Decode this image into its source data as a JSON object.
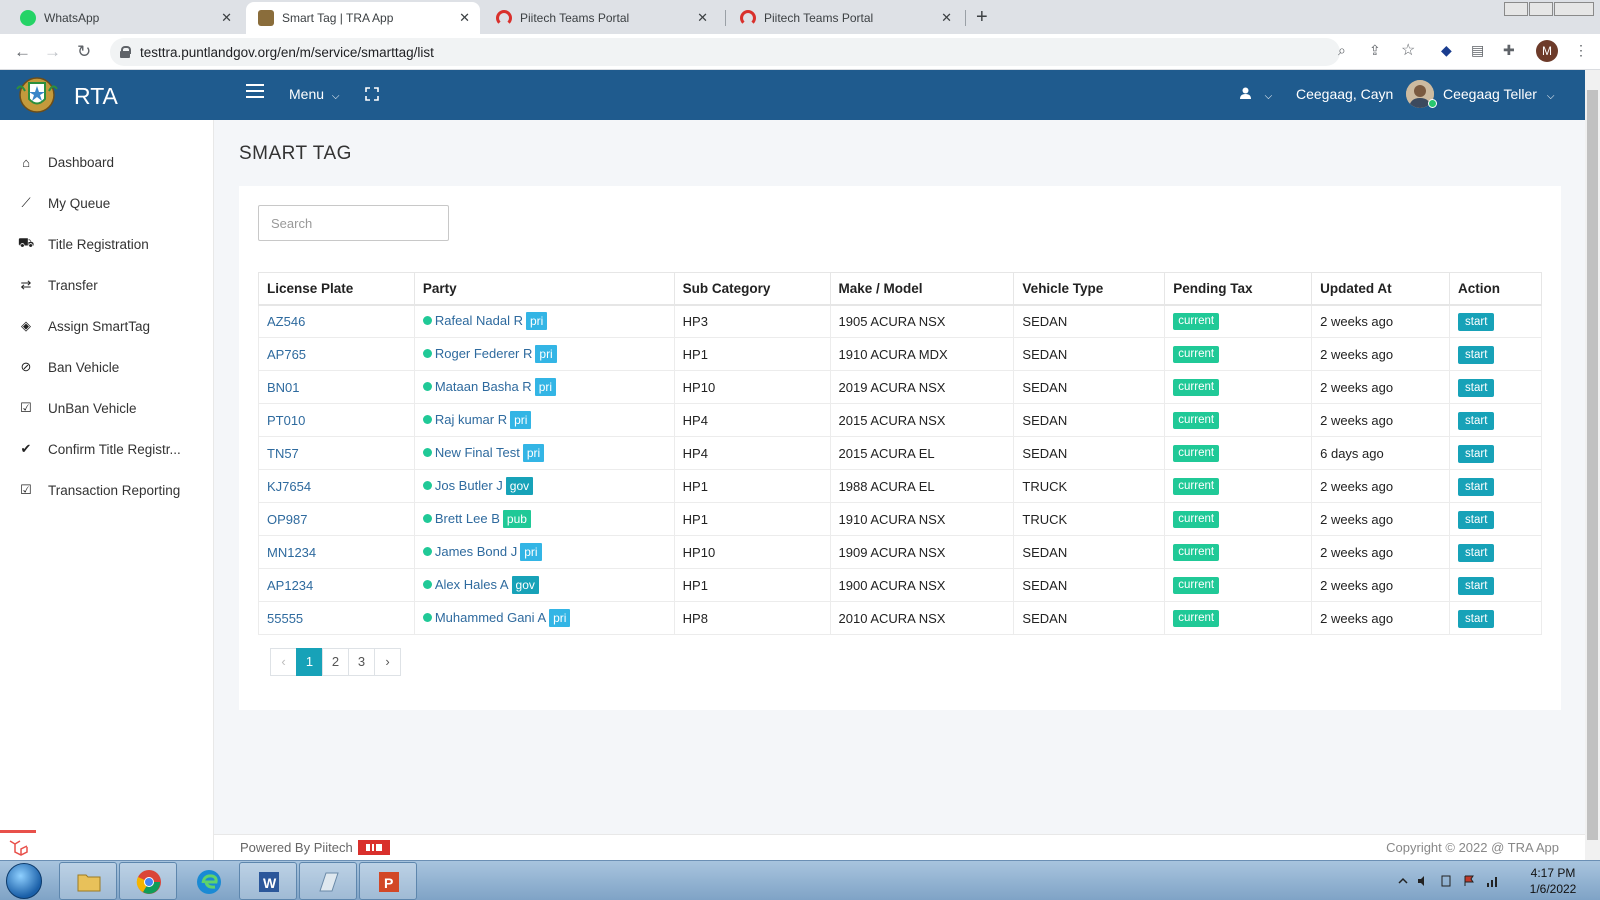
{
  "browser": {
    "tabs": [
      {
        "title": "WhatsApp",
        "icon": "whatsapp-icon",
        "active": false
      },
      {
        "title": "Smart Tag | TRA App",
        "icon": "emblem-icon",
        "active": true
      },
      {
        "title": "Piitech Teams Portal",
        "icon": "piitech-icon",
        "active": false
      },
      {
        "title": "Piitech Teams Portal",
        "icon": "piitech-icon",
        "active": false
      }
    ],
    "url": "testtra.puntlandgov.org/en/m/service/smarttag/list",
    "profile_initial": "M"
  },
  "header": {
    "brand": "RTA",
    "menu_label": "Menu",
    "branch": "Ceegaag, Cayn",
    "user_name": "Ceegaag Teller"
  },
  "sidebar": {
    "items": [
      {
        "label": "Dashboard",
        "icon": "home-icon"
      },
      {
        "label": "My Queue",
        "icon": "trend-icon"
      },
      {
        "label": "Title Registration",
        "icon": "car-icon"
      },
      {
        "label": "Transfer",
        "icon": "exchange-icon"
      },
      {
        "label": "Assign SmartTag",
        "icon": "tags-icon"
      },
      {
        "label": "Ban Vehicle",
        "icon": "ban-icon"
      },
      {
        "label": "UnBan Vehicle",
        "icon": "check-square-icon"
      },
      {
        "label": "Confirm Title Registr...",
        "icon": "check-icon"
      },
      {
        "label": "Transaction Reporting",
        "icon": "check-square-icon"
      }
    ]
  },
  "page": {
    "title": "SMART TAG",
    "search_placeholder": "Search"
  },
  "table": {
    "columns": [
      "License Plate",
      "Party",
      "Sub Category",
      "Make / Model",
      "Vehicle Type",
      "Pending Tax",
      "Updated At",
      "Action"
    ],
    "rows": [
      {
        "plate": "AZ546",
        "party": "Rafeal Nadal R",
        "party_type": "pri",
        "sub": "HP3",
        "make": "1905 ACURA NSX",
        "vtype": "SEDAN",
        "tax": "current",
        "updated": "2 weeks ago",
        "action": "start"
      },
      {
        "plate": "AP765",
        "party": "Roger Federer R",
        "party_type": "pri",
        "sub": "HP1",
        "make": "1910 ACURA MDX",
        "vtype": "SEDAN",
        "tax": "current",
        "updated": "2 weeks ago",
        "action": "start"
      },
      {
        "plate": "BN01",
        "party": "Mataan Basha R",
        "party_type": "pri",
        "sub": "HP10",
        "make": "2019 ACURA NSX",
        "vtype": "SEDAN",
        "tax": "current",
        "updated": "2 weeks ago",
        "action": "start"
      },
      {
        "plate": "PT010",
        "party": "Raj kumar R",
        "party_type": "pri",
        "sub": "HP4",
        "make": "2015 ACURA NSX",
        "vtype": "SEDAN",
        "tax": "current",
        "updated": "2 weeks ago",
        "action": "start"
      },
      {
        "plate": "TN57",
        "party": "New Final Test",
        "party_type": "pri",
        "sub": "HP4",
        "make": "2015 ACURA EL",
        "vtype": "SEDAN",
        "tax": "current",
        "updated": "6 days ago",
        "action": "start"
      },
      {
        "plate": "KJ7654",
        "party": "Jos Butler J",
        "party_type": "gov",
        "sub": "HP1",
        "make": "1988 ACURA EL",
        "vtype": "TRUCK",
        "tax": "current",
        "updated": "2 weeks ago",
        "action": "start"
      },
      {
        "plate": "OP987",
        "party": "Brett Lee B",
        "party_type": "pub",
        "sub": "HP1",
        "make": "1910 ACURA NSX",
        "vtype": "TRUCK",
        "tax": "current",
        "updated": "2 weeks ago",
        "action": "start"
      },
      {
        "plate": "MN1234",
        "party": "James Bond J",
        "party_type": "pri",
        "sub": "HP10",
        "make": "1909 ACURA NSX",
        "vtype": "SEDAN",
        "tax": "current",
        "updated": "2 weeks ago",
        "action": "start"
      },
      {
        "plate": "AP1234",
        "party": "Alex Hales A",
        "party_type": "gov",
        "sub": "HP1",
        "make": "1900 ACURA NSX",
        "vtype": "SEDAN",
        "tax": "current",
        "updated": "2 weeks ago",
        "action": "start"
      },
      {
        "plate": "55555",
        "party": "Muhammed Gani A",
        "party_type": "pri",
        "sub": "HP8",
        "make": "2010 ACURA NSX",
        "vtype": "SEDAN",
        "tax": "current",
        "updated": "2 weeks ago",
        "action": "start"
      }
    ]
  },
  "pagination": {
    "prev": "‹",
    "pages": [
      "1",
      "2",
      "3"
    ],
    "current": "1",
    "next": "›"
  },
  "footer": {
    "powered_by": "Powered By Piitech",
    "copyright": "Copyright © 2022 @ TRA App"
  },
  "taskbar": {
    "time": "4:17 PM",
    "date": "1/6/2022"
  },
  "colors": {
    "header_bg": "#1f5b8e",
    "accent_teal": "#17a2b8",
    "status_green": "#20c997",
    "party_type": {
      "pri": "#33b5e5",
      "gov": "#17a2b8",
      "pub": "#20c997"
    }
  }
}
